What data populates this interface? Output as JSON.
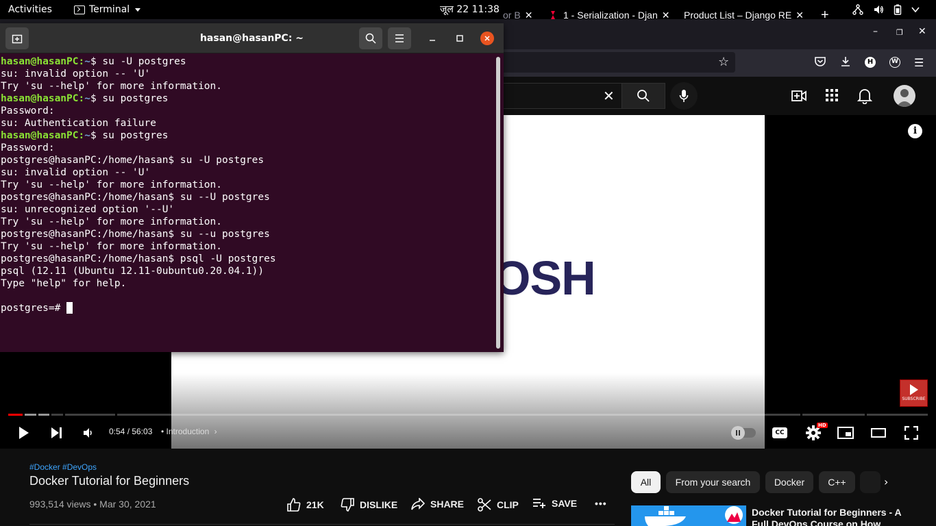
{
  "system_bar": {
    "activities": "Activities",
    "app_name": "Terminal",
    "clock": "जूल 22  11:38"
  },
  "browser": {
    "tabs": [
      {
        "label": "or B"
      },
      {
        "label": "1 - Serialization - Djan"
      },
      {
        "label": "Product List – Django RE"
      }
    ],
    "new_tab": "+"
  },
  "youtube": {
    "video": {
      "logo_text": "OSH",
      "time_current": "0:54",
      "time_total": "56:03",
      "time_display": "0:54 / 56:03",
      "chapter": "Introduction",
      "progress_fraction": 0.016,
      "buffered_fraction": 0.046,
      "subscribe_watermark": "SUBSCRIBE"
    },
    "hashtags": "#Docker #DevOps",
    "title": "Docker Tutorial for Beginners",
    "views": "993,514 views",
    "date": "Mar 30, 2021",
    "meta": "993,514 views • Mar 30, 2021",
    "actions": {
      "likes": "21K",
      "dislike": "DISLIKE",
      "share": "SHARE",
      "clip": "CLIP",
      "save": "SAVE"
    },
    "chips": [
      "All",
      "From your search",
      "Docker",
      "C++"
    ],
    "recommended": {
      "title": "Docker Tutorial for Beginners - A Full DevOps Course on How"
    }
  },
  "terminal": {
    "title": "hasan@hasanPC: ~",
    "lines": [
      {
        "user": "hasan@hasanPC",
        "path": "~",
        "cmd": "$ su -U postgres"
      },
      {
        "text": "su: invalid option -- 'U'"
      },
      {
        "text": "Try 'su --help' for more information."
      },
      {
        "user": "hasan@hasanPC",
        "path": "~",
        "cmd": "$ su postgres"
      },
      {
        "text": "Password:"
      },
      {
        "text": "su: Authentication failure"
      },
      {
        "user": "hasan@hasanPC",
        "path": "~",
        "cmd": "$ su postgres"
      },
      {
        "text": "Password:"
      },
      {
        "text": "postgres@hasanPC:/home/hasan$ su -U postgres"
      },
      {
        "text": "su: invalid option -- 'U'"
      },
      {
        "text": "Try 'su --help' for more information."
      },
      {
        "text": "postgres@hasanPC:/home/hasan$ su --U postgres"
      },
      {
        "text": "su: unrecognized option '--U'"
      },
      {
        "text": "Try 'su --help' for more information."
      },
      {
        "text": "postgres@hasanPC:/home/hasan$ su --u postgres"
      },
      {
        "text": "Try 'su --help' for more information."
      },
      {
        "text": "postgres@hasanPC:/home/hasan$ psql -U postgres"
      },
      {
        "text": "psql (12.11 (Ubuntu 12.11-0ubuntu0.20.04.1))"
      },
      {
        "text": "Type \"help\" for help."
      },
      {
        "text": ""
      }
    ],
    "prompt": "postgres=# "
  },
  "colors": {
    "terminal_bg": "#300a24",
    "prompt_user": "#8ae234",
    "prompt_path": "#729fcf",
    "close_button": "#e95420",
    "youtube_red": "#ff0000"
  }
}
